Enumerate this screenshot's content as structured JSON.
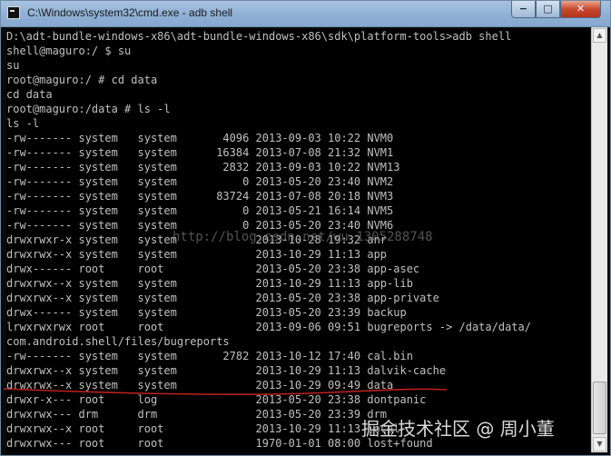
{
  "window": {
    "title": "C:\\Windows\\system32\\cmd.exe - adb  shell",
    "controls": {
      "minimize": "−",
      "maximize": "□",
      "close": "✕"
    }
  },
  "console": {
    "lines": [
      "D:\\adt-bundle-windows-x86\\adt-bundle-windows-x86\\sdk\\platform-tools>adb shell",
      "shell@maguro:/ $ su",
      "su",
      "root@maguro:/ # cd data",
      "cd data",
      "root@maguro:/data # ls -l",
      "ls -l",
      "-rw------- system   system       4096 2013-09-03 10:22 NVM0",
      "-rw------- system   system      16384 2013-07-08 21:32 NVM1",
      "-rw------- system   system       2832 2013-09-03 10:22 NVM13",
      "-rw------- system   system          0 2013-05-20 23:40 NVM2",
      "-rw------- system   system      83724 2013-07-08 20:18 NVM3",
      "-rw------- system   system          0 2013-05-21 16:14 NVM5",
      "-rw------- system   system          0 2013-05-20 23:40 NVM6",
      "drwxrwxr-x system   system            2013-10-28 19:32 anr",
      "drwxrwx--x system   system            2013-10-29 11:13 app",
      "drwx------ root     root              2013-05-20 23:38 app-asec",
      "drwxrwx--x system   system            2013-10-29 11:13 app-lib",
      "drwxrwx--x system   system            2013-05-20 23:38 app-private",
      "drwx------ system   system            2013-05-20 23:39 backup",
      "lrwxrwxrwx root     root              2013-09-06 09:51 bugreports -> /data/data/",
      "com.android.shell/files/bugreports",
      "-rw------- system   system       2782 2013-10-12 17:40 cal.bin",
      "drwxrwx--x system   system            2013-10-29 11:13 dalvik-cache",
      "drwxrwx--x system   system            2013-10-29 09:49 data",
      "drwxr-x--- root     log               2013-05-20 23:38 dontpanic",
      "drwxrwx--- drm      drm               2013-05-20 23:39 drm",
      "drwxrwx--x root     root              2013-10-29 11:13 local",
      "drwxrwx--- root     root              1970-01-01 08:00 lost+found"
    ]
  },
  "overlay": {
    "watermark_url": "http://blog.csdn.net/wu_1305288748",
    "brand_text": "掘金技术社区 @ 周小董"
  },
  "colors": {
    "console_bg": "#000000",
    "console_text": "#c0c0c0",
    "underline": "#c0201e"
  }
}
